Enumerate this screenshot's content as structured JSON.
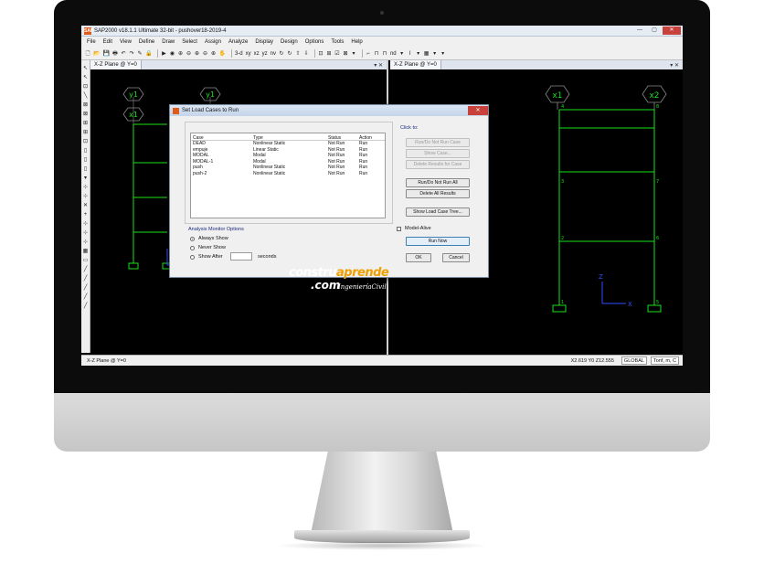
{
  "app": {
    "title": "SAP2000 v18.1.1 Ultimate 32-bit - pushover18-2019-4",
    "icon": "SAP",
    "window_controls": [
      "—",
      "▢",
      "✕"
    ]
  },
  "menu": [
    "File",
    "Edit",
    "View",
    "Define",
    "Draw",
    "Select",
    "Assign",
    "Analyze",
    "Display",
    "Design",
    "Options",
    "Tools",
    "Help"
  ],
  "toolbar": [
    "🗋",
    "📂",
    "💾",
    "🖶",
    "↶",
    "↷",
    "✎",
    "🔒",
    "▶",
    "◉",
    "⊕",
    "⊖",
    "⊕",
    "⊖",
    "⊕",
    "✋",
    "3-d",
    "xy",
    "xz",
    "yz",
    "nv",
    "↻",
    "↻",
    "⇧",
    "⇩",
    "⊡",
    "⊞",
    "☑",
    "⊠",
    "▾",
    "⌐",
    "⊓",
    "⊓",
    "nd",
    "▾",
    "I",
    "▾",
    "▦",
    "▾",
    "▾"
  ],
  "side_toolbar": [
    "↖",
    "↖",
    "⊡",
    "╲",
    "⊠",
    "⊠",
    "⊞",
    "⊞",
    "⊡",
    "▯",
    "▯",
    "▯",
    "▾",
    "⊹",
    "⊹",
    "✕",
    "+",
    "⊹",
    "⊹",
    "⊹",
    "▦",
    "▭",
    "╱",
    "╱",
    "╱",
    "╱",
    "╱"
  ],
  "panes": {
    "left": {
      "tab": "X-Z Plane @ Y=0",
      "ctrl": "▾ ✕",
      "grid_labels": [
        "y1",
        "x1",
        "y1"
      ],
      "axis_x": "X",
      "axis_z": "Z"
    },
    "right": {
      "tab": "X-Z Plane @ Y=0",
      "ctrl": "▾ ✕",
      "grid_labels": [
        "x1",
        "x2"
      ],
      "joint_labels": [
        "4",
        "8",
        "3",
        "7",
        "2",
        "6",
        "1",
        "5"
      ],
      "axis_x": "X",
      "axis_z": "Z"
    }
  },
  "status": {
    "left": "X-Z Plane @ Y=0",
    "coords": "X2.619  Y0  Z12.555",
    "system": "GLOBAL",
    "units": "Tonf, m, C"
  },
  "dialog": {
    "title": "Set Load Cases to Run",
    "close": "✕",
    "columns": [
      "Case",
      "Type",
      "Status",
      "Action"
    ],
    "cases": [
      {
        "case": "DEAD",
        "type": "Nonlinear Static",
        "status": "Not Run",
        "action": "Run"
      },
      {
        "case": "empuje",
        "type": "Linear Static",
        "status": "Not Run",
        "action": "Run"
      },
      {
        "case": "MODAL",
        "type": "Modal",
        "status": "Not Run",
        "action": "Run"
      },
      {
        "case": "MODAL-1",
        "type": "Modal",
        "status": "Not Run",
        "action": "Run"
      },
      {
        "case": "push",
        "type": "Nonlinear Static",
        "status": "Not Run",
        "action": "Run"
      },
      {
        "case": "push-2",
        "type": "Nonlinear Static",
        "status": "Not Run",
        "action": "Run"
      }
    ],
    "click_to": "Click to:",
    "btn_run_do_not_run_case": "Run/Do Not Run Case",
    "btn_show_case": "Show Case...",
    "btn_delete_results_case": "Delete Results for Case",
    "btn_run_do_not_run_all": "Run/Do Not Run All",
    "btn_delete_all_results": "Delete All Results",
    "btn_show_load_case_tree": "Show Load Case Tree...",
    "analysis_monitor_label": "Analysis Monitor Options",
    "radio_always": "Always Show",
    "radio_never": "Never Show",
    "radio_after": "Show After",
    "seconds": "seconds",
    "model_alive": "Model-Alive",
    "btn_run_now": "Run Now",
    "btn_ok": "OK",
    "btn_cancel": "Cancel"
  },
  "watermark": {
    "line1a": "constru",
    "line1b": "aprende",
    "line2": ".com",
    "line3": "IngenieríaCivil"
  },
  "colors": {
    "structure": "#19e01a",
    "gridline": "#8a8a8a",
    "axis": "#3050ff",
    "brand_accent": "#f0a000"
  }
}
